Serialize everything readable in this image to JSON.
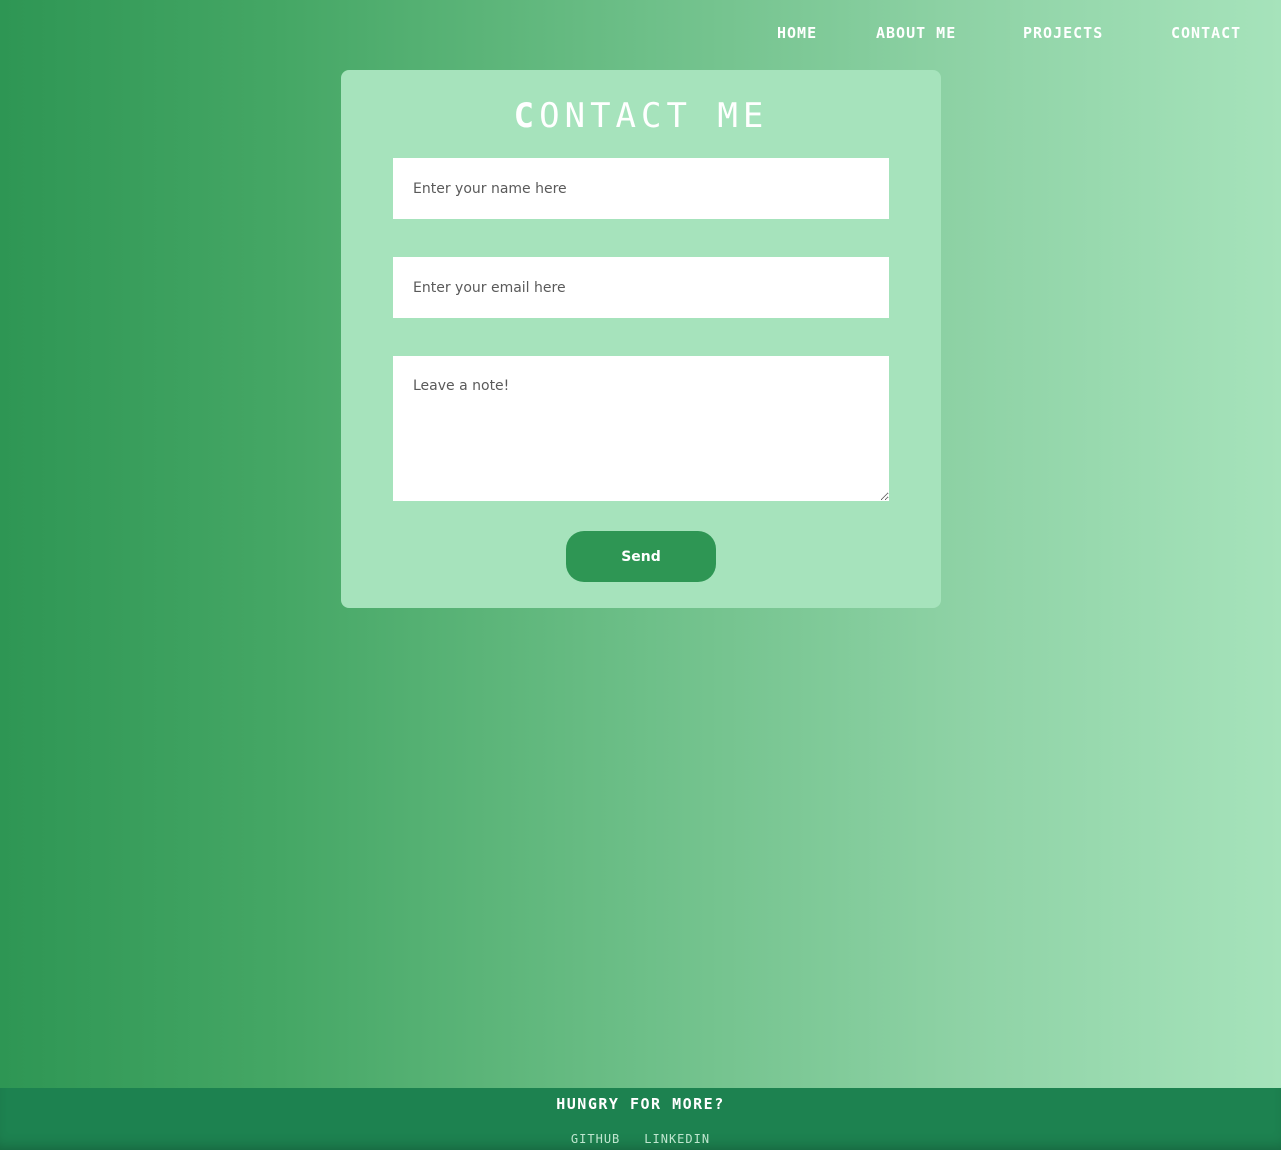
{
  "nav": {
    "home": "HOME",
    "about": "ABOUT ME",
    "projects": "PROJECTS",
    "contact": "CONTACT"
  },
  "contact_form": {
    "title_first_letter": "C",
    "title_rest": "ONTACT ME",
    "name_placeholder": "Enter your name here",
    "email_placeholder": "Enter your email here",
    "note_placeholder": "Leave a note!",
    "send_label": "Send"
  },
  "footer": {
    "title": "HUNGRY FOR MORE?",
    "links": [
      "GITHUB",
      "LINKEDIN"
    ]
  },
  "colors": {
    "gradient_start": "#2e9654",
    "gradient_end": "#a6e3bb",
    "card": "#a6e3bc",
    "button": "#2e9654",
    "footer": "#1d8250"
  }
}
